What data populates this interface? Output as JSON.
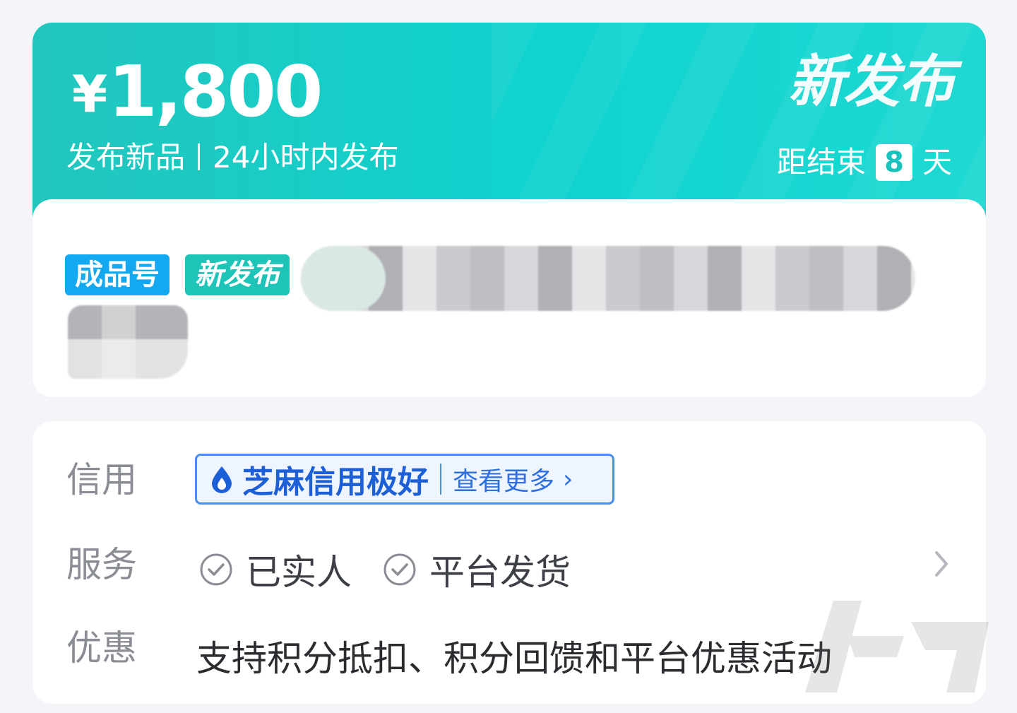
{
  "banner": {
    "currency": "¥",
    "price": "1,800",
    "subtitle_left": "发布新品",
    "subtitle_right": "24小时内发布",
    "big_tag": "新发布",
    "countdown_prefix": "距结束",
    "countdown_days": "8",
    "countdown_suffix": "天",
    "accent_color": "#1fd3cf"
  },
  "title_card": {
    "tags": [
      "成品号",
      "新发布"
    ]
  },
  "info": {
    "credit": {
      "label": "信用",
      "badge_text": "芝麻信用极好",
      "more_text": "查看更多",
      "icon": "droplet-icon"
    },
    "service": {
      "label": "服务",
      "items": [
        "已实人",
        "平台发货"
      ],
      "icon": "check-circle-icon"
    },
    "promo": {
      "label": "优惠",
      "text": "支持积分抵扣、积分回馈和平台优惠活动"
    }
  }
}
